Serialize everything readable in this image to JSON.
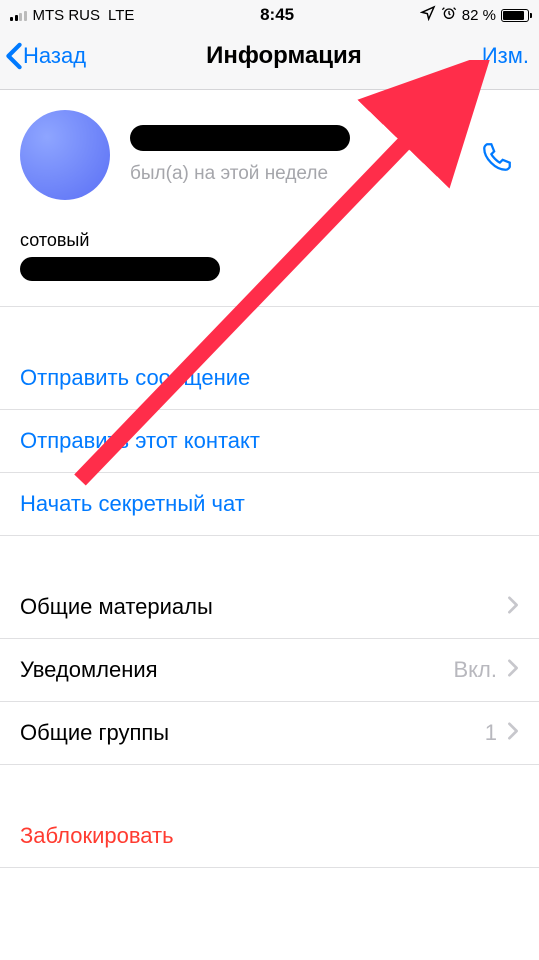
{
  "status": {
    "carrier": "MTS RUS",
    "network": "LTE",
    "time": "8:45",
    "battery_pct": "82 %"
  },
  "nav": {
    "back": "Назад",
    "title": "Информация",
    "edit": "Изм."
  },
  "profile": {
    "name_redacted": true,
    "status": "был(а) на этой неделе"
  },
  "phone": {
    "label": "сотовый",
    "value_redacted": true
  },
  "actions": {
    "send_message": "Отправить сообщение",
    "share_contact": "Отправить этот контакт",
    "secret_chat": "Начать секретный чат"
  },
  "settings": {
    "shared_media": {
      "label": "Общие материалы"
    },
    "notifications": {
      "label": "Уведомления",
      "value": "Вкл."
    },
    "groups": {
      "label": "Общие группы",
      "value": "1"
    }
  },
  "block": {
    "label": "Заблокировать"
  },
  "colors": {
    "accent": "#007aff",
    "destructive": "#ff3b30"
  }
}
